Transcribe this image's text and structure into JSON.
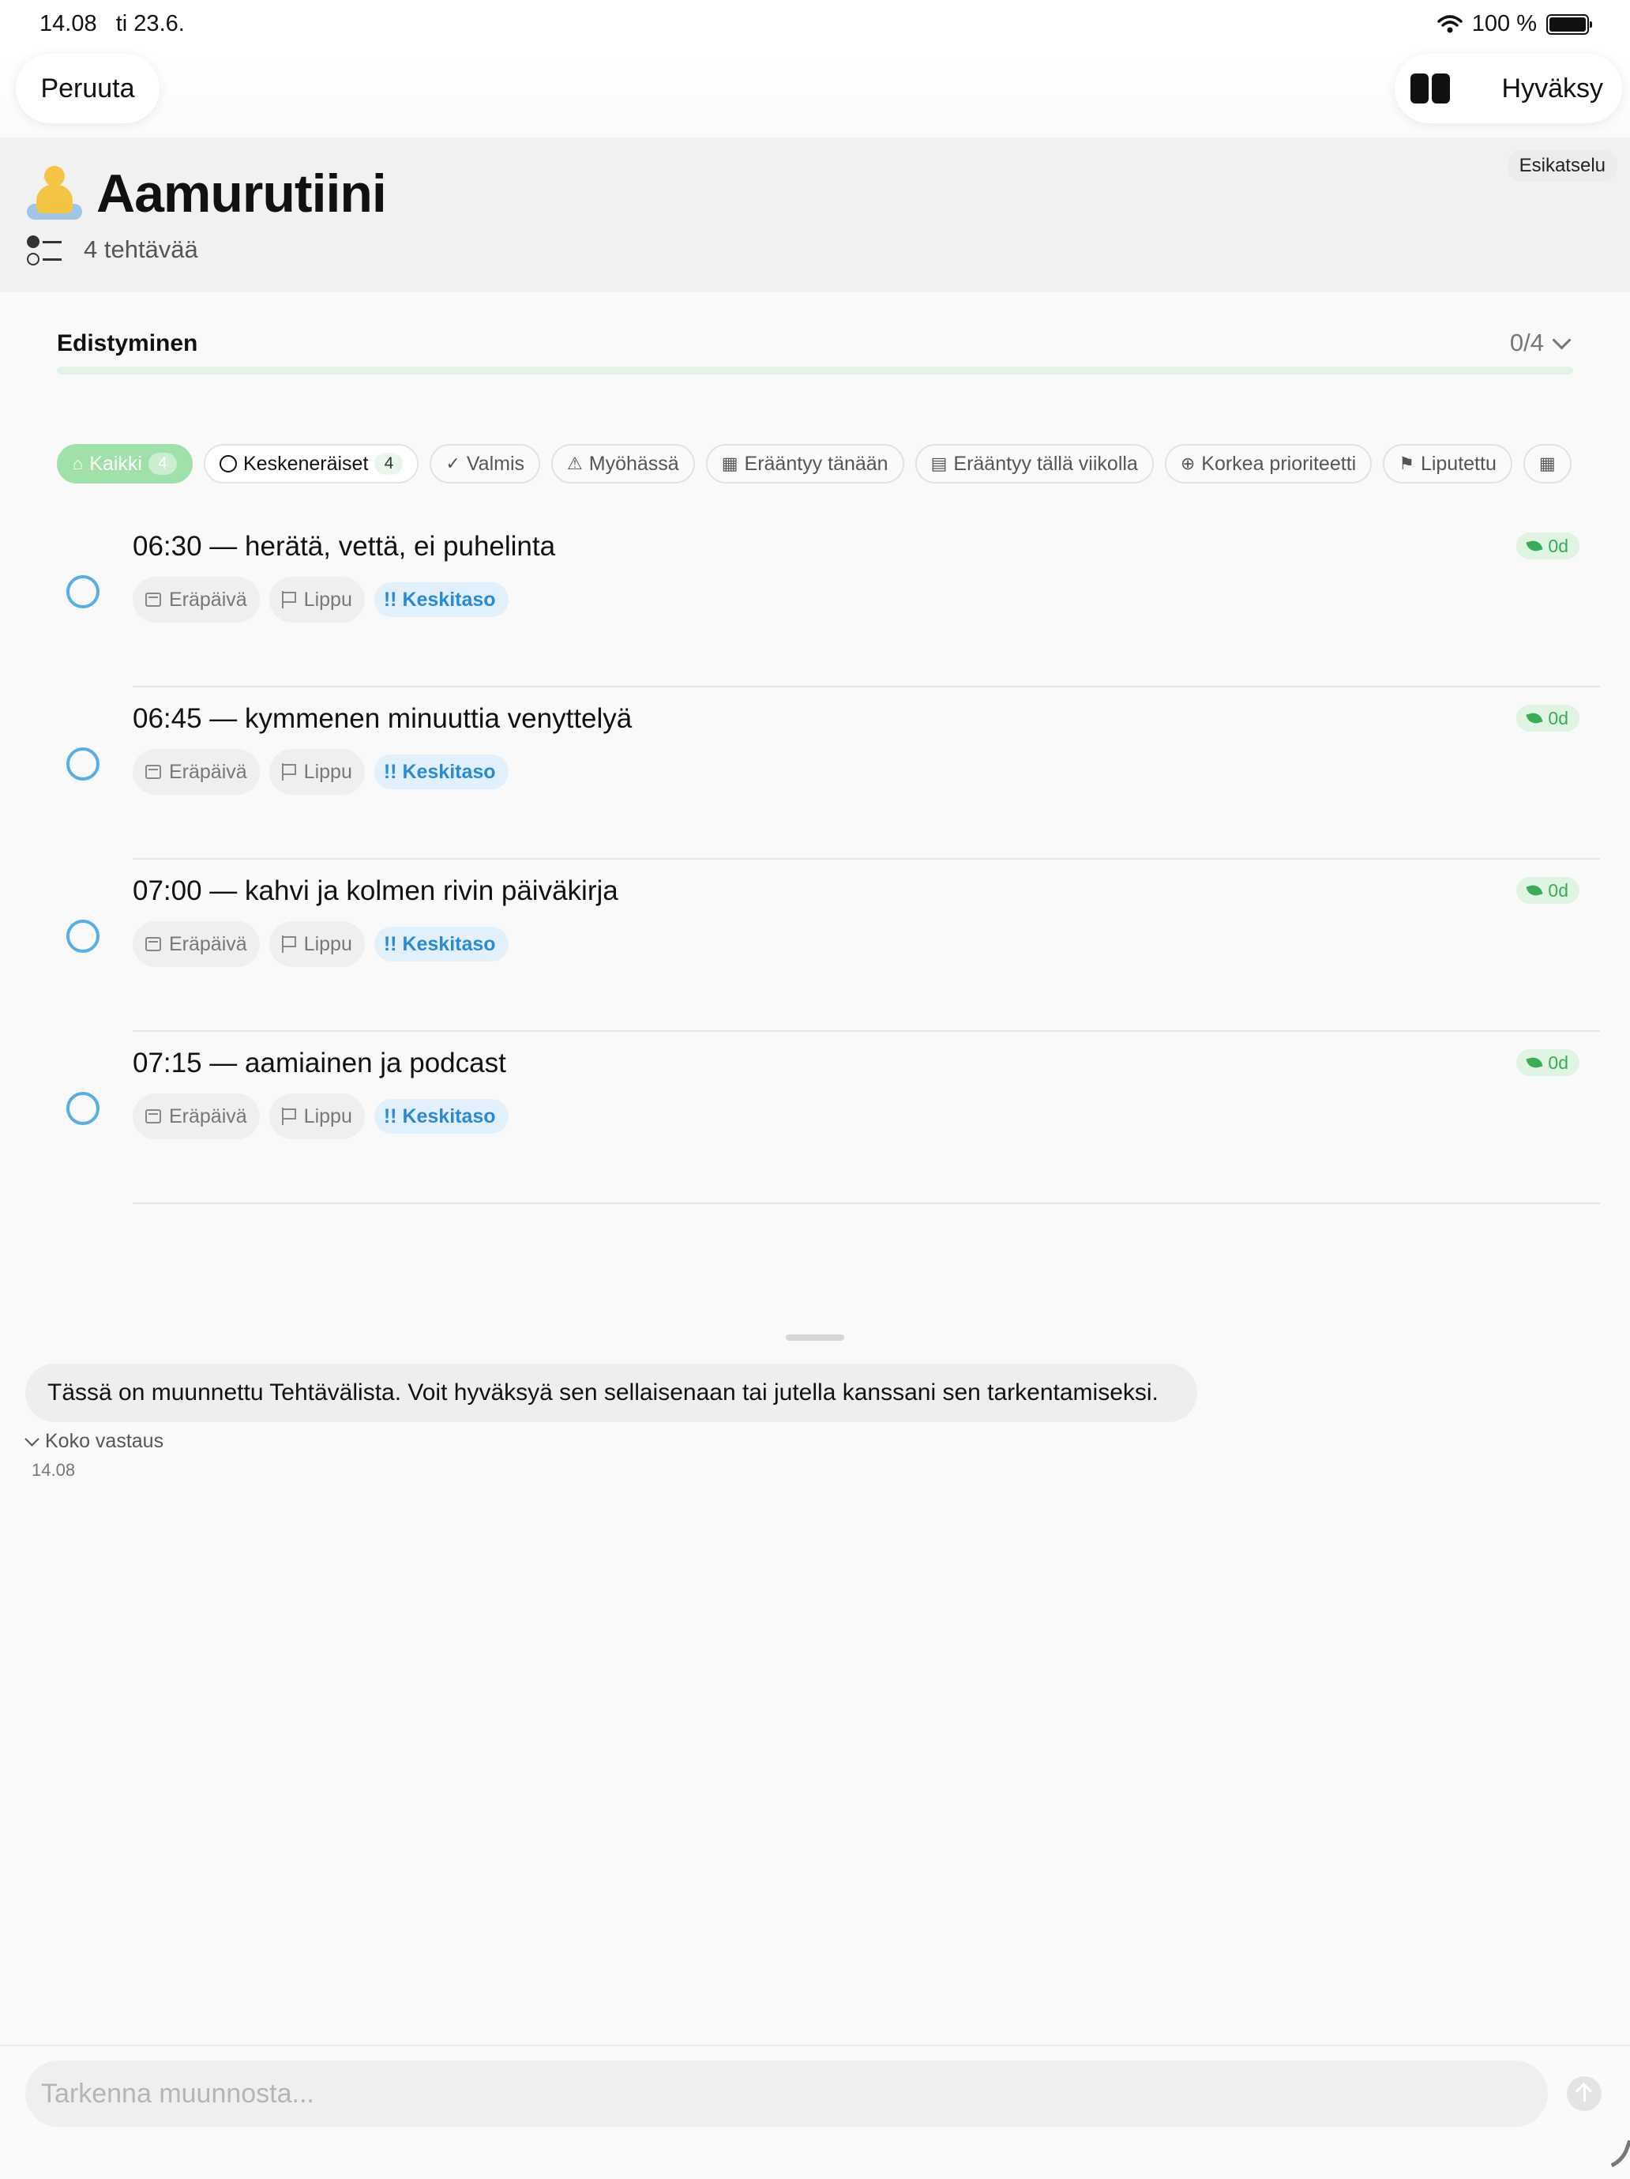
{
  "status_bar": {
    "time": "14.08",
    "date": "ti 23.6.",
    "battery": "100 %"
  },
  "nav": {
    "cancel_label": "Peruuta",
    "accept_label": "Hyväksy",
    "split_view_icon": "sidebar-split-icon"
  },
  "header": {
    "preview_label": "Esikatselu",
    "title": "Aamurutiini",
    "emoji_icon": "person-in-lotus-position-icon",
    "task_count_label": "4 tehtävää"
  },
  "progress": {
    "label": "Edistyminen",
    "count": "0/4",
    "value": 0
  },
  "filters": [
    {
      "label": "Kaikki",
      "count": "4",
      "icon": "tray-icon",
      "active": true
    },
    {
      "label": "Keskeneräiset",
      "count": "4",
      "icon": "circle-icon",
      "active": false
    },
    {
      "label": "Valmis",
      "count": "",
      "icon": "check-circle-icon",
      "active": false
    },
    {
      "label": "Myöhässä",
      "count": "",
      "icon": "warning-triangle-icon",
      "active": false
    },
    {
      "label": "Erääntyy tänään",
      "count": "",
      "icon": "calendar-clock-icon",
      "active": false
    },
    {
      "label": "Erääntyy tällä viikolla",
      "count": "",
      "icon": "calendar-icon",
      "active": false
    },
    {
      "label": "Korkea prioriteetti",
      "count": "",
      "icon": "arrow-up-circle-icon",
      "active": false
    },
    {
      "label": "Liputettu",
      "count": "",
      "icon": "flag-icon",
      "active": false
    }
  ],
  "tasks": [
    {
      "title": "06:30 — herätä, vettä, ei puhelinta",
      "due_label": "Eräpäivä",
      "flag_label": "Lippu",
      "priority_label": "!! Keskitaso",
      "age_label": "0d"
    },
    {
      "title": "06:45 — kymmenen minuuttia venyttelyä",
      "due_label": "Eräpäivä",
      "flag_label": "Lippu",
      "priority_label": "!! Keskitaso",
      "age_label": "0d"
    },
    {
      "title": "07:00 — kahvi ja kolmen rivin päiväkirja",
      "due_label": "Eräpäivä",
      "flag_label": "Lippu",
      "priority_label": "!! Keskitaso",
      "age_label": "0d"
    },
    {
      "title": "07:15 — aamiainen ja podcast",
      "due_label": "Eräpäivä",
      "flag_label": "Lippu",
      "priority_label": "!! Keskitaso",
      "age_label": "0d"
    }
  ],
  "chat": {
    "message": "Tässä on muunnettu Tehtävälista. Voit hyväksyä sen sellaisenaan tai jutella kanssani sen tarkentamiseksi.",
    "full_answer_label": "Koko vastaus",
    "time": "14.08"
  },
  "composer": {
    "placeholder": "Tarkenna muunnosta..."
  },
  "colors": {
    "accent_green": "#3cb55a",
    "active_chip": "#a0e0a9",
    "circle_blue": "#57aee6",
    "priority_blue": "#2a8ad6"
  }
}
